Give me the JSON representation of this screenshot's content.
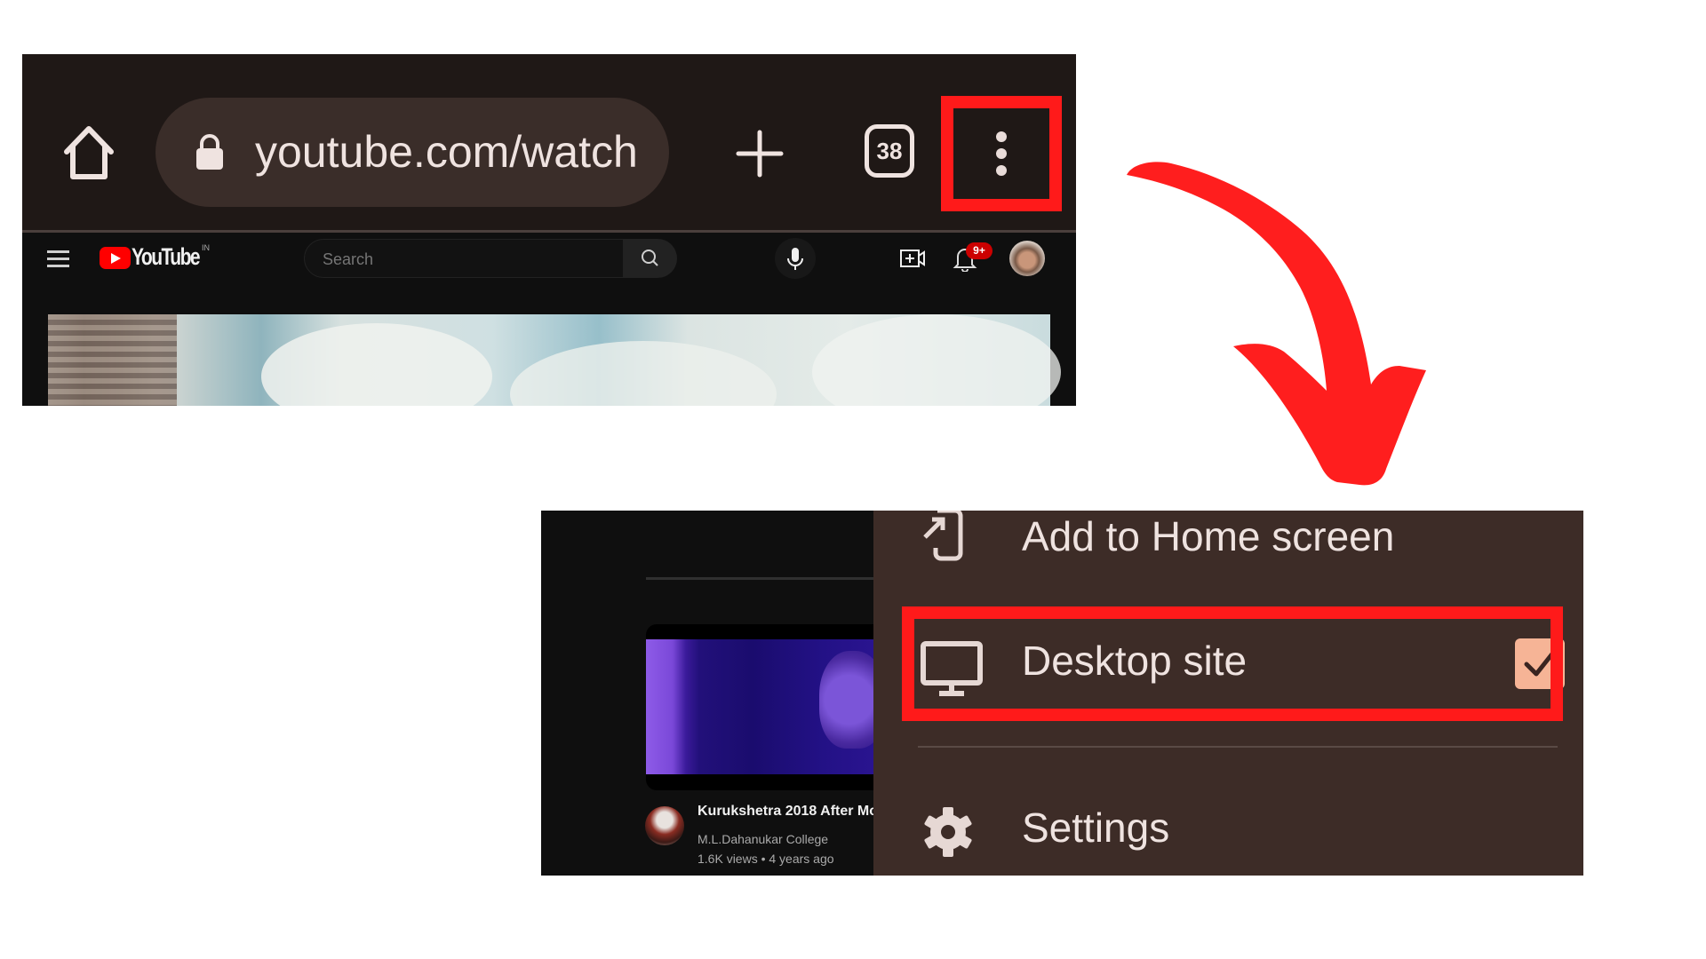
{
  "browser": {
    "url": "youtube.com/watch",
    "tab_count": "38",
    "icons": {
      "home": "home-icon",
      "lock": "lock-icon",
      "new_tab": "plus-icon",
      "tabs": "tab-switcher-icon",
      "menu": "more-vert-icon"
    }
  },
  "youtube": {
    "logo_text": "YouTube",
    "region": "IN",
    "search_placeholder": "Search",
    "notification_badge": "9+",
    "brand_color": "#ff0000",
    "recommended_video": {
      "title": "Kurukshetra 2018 After Mc",
      "channel": "M.L.Dahanukar College",
      "meta": "1.6K views • 4 years ago"
    }
  },
  "overflow_menu": {
    "items": [
      {
        "label": "Add to Home screen",
        "icon": "add-to-home-icon"
      },
      {
        "label": "Desktop site",
        "icon": "monitor-icon",
        "checked": true
      },
      {
        "label": "Settings",
        "icon": "gear-icon"
      }
    ],
    "checkbox_color": "#f6b496"
  },
  "annotations": {
    "highlight_color": "#ff1a1a",
    "highlighted": [
      "menu-button",
      "desktop-site-item"
    ],
    "arrow": "curved-arrow-down-right"
  }
}
